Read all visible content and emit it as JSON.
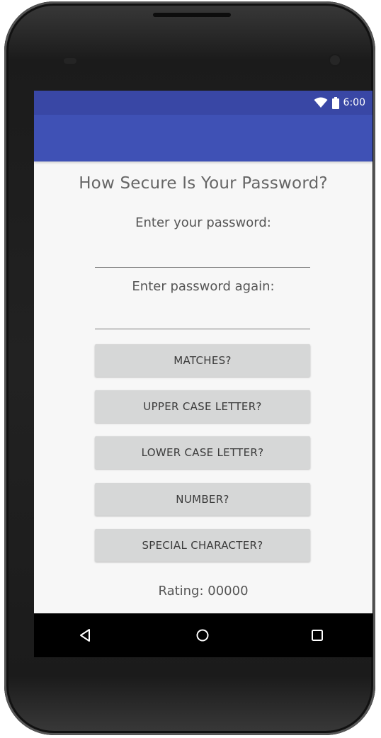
{
  "status_bar": {
    "time": "6:00",
    "icons": [
      "wifi-icon",
      "battery-icon"
    ],
    "color": "#3947a5"
  },
  "app_bar": {
    "color": "#3f51b5"
  },
  "main": {
    "title": "How Secure Is Your Password?",
    "password_label": "Enter your password:",
    "password_value": "",
    "password_again_label": "Enter password again:",
    "password_again_value": "",
    "buttons": [
      {
        "label": "MATCHES?"
      },
      {
        "label": "UPPER CASE LETTER?"
      },
      {
        "label": "LOWER CASE LETTER?"
      },
      {
        "label": "NUMBER?"
      },
      {
        "label": "SPECIAL CHARACTER?"
      }
    ],
    "rating": "Rating: 00000"
  },
  "nav_bar": {
    "icons": [
      "back-icon",
      "home-icon",
      "recents-icon"
    ]
  },
  "colors": {
    "primary": "#3f51b5",
    "primary_dark": "#3947a5",
    "button_bg": "#d6d7d7",
    "screen_bg": "#f7f7f7"
  }
}
